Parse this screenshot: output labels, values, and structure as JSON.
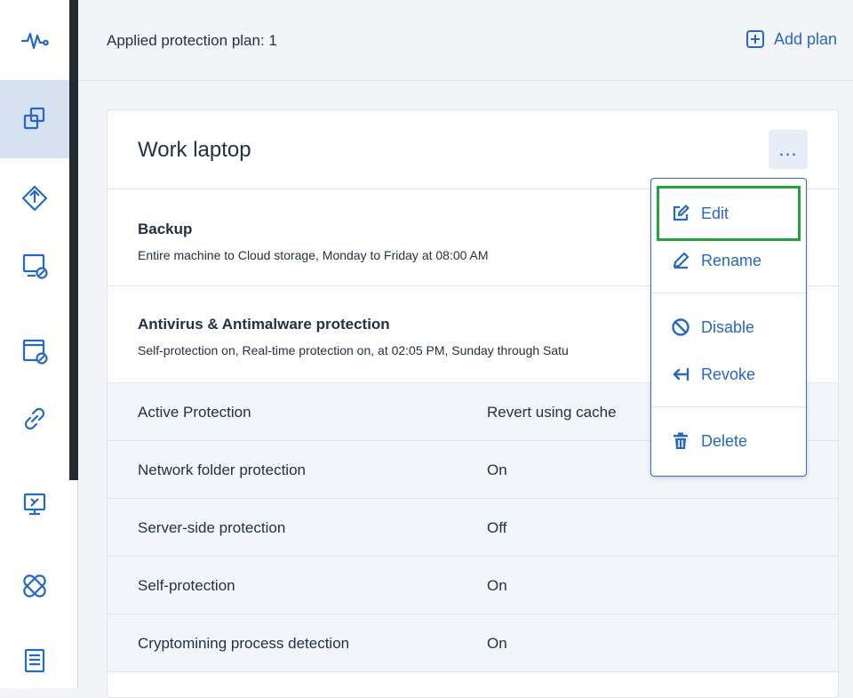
{
  "rail": {
    "items": [
      {
        "icon": "activity-icon"
      },
      {
        "icon": "protection-plans-icon",
        "active": true
      },
      {
        "icon": "backup-upload-icon"
      },
      {
        "icon": "devices-disconnect-icon"
      },
      {
        "icon": "browser-disconnect-icon"
      },
      {
        "icon": "link-icon"
      },
      {
        "icon": "remote-desktop-icon"
      },
      {
        "icon": "patch-icon"
      },
      {
        "icon": "reports-icon"
      }
    ]
  },
  "header": {
    "applied_label": "Applied protection plan: 1",
    "add_plan_label": "Add plan"
  },
  "plan": {
    "title": "Work laptop",
    "more_label": "...",
    "backup": {
      "title": "Backup",
      "description": "Entire machine to Cloud storage, Monday to Friday at 08:00 AM"
    },
    "antivirus": {
      "title": "Antivirus & Antimalware protection",
      "description": "Self-protection on, Real-time protection on, at 02:05 PM, Sunday through Satu"
    },
    "rows": [
      {
        "key": "Active Protection",
        "value": "Revert using cache"
      },
      {
        "key": "Network folder protection",
        "value": "On"
      },
      {
        "key": "Server-side protection",
        "value": "Off"
      },
      {
        "key": "Self-protection",
        "value": "On"
      },
      {
        "key": "Cryptomining process detection",
        "value": "On"
      }
    ]
  },
  "menu": {
    "edit": "Edit",
    "rename": "Rename",
    "disable": "Disable",
    "revoke": "Revoke",
    "delete": "Delete"
  },
  "colors": {
    "accent": "#2668c5",
    "highlight": "#22a33b",
    "rail_active": "#d7e2f1"
  }
}
